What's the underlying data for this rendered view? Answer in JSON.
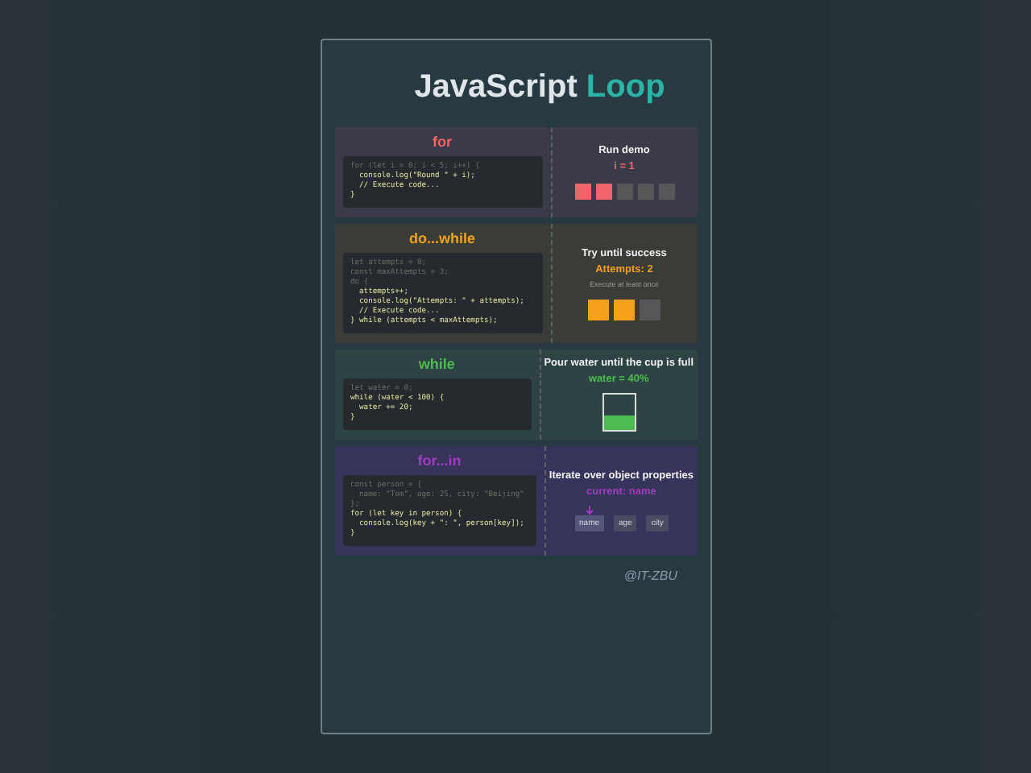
{
  "title": {
    "text": "JavaScript",
    "accent": "Loop"
  },
  "sections": [
    {
      "kind": "squares",
      "heading": "for",
      "color": "#f0656a",
      "code": [
        {
          "text": "for (let i = 0; i < 5; i++) {",
          "dim": true
        },
        {
          "text": "  console.log(\"Round \" + i);",
          "dim": false
        },
        {
          "text": "  // Execute code...",
          "dim": false
        },
        {
          "text": "}",
          "dim": false
        }
      ],
      "demo_title": "Run demo",
      "status": "i = 1",
      "cells": [
        {
          "on": true
        },
        {
          "on": true
        },
        {
          "on": false
        },
        {
          "on": false
        },
        {
          "on": false
        }
      ]
    },
    {
      "kind": "squares",
      "heading": "do...while",
      "color": "#f5a01a",
      "code": [
        {
          "text": "let attempts = 0;",
          "dim": true
        },
        {
          "text": "const maxAttempts = 3;",
          "dim": true
        },
        {
          "text": "do {",
          "dim": true
        },
        {
          "text": "  attempts++;",
          "dim": false
        },
        {
          "text": "  console.log(\"Attempts: \" + attempts);",
          "dim": false
        },
        {
          "text": "  // Execute code...",
          "dim": false
        },
        {
          "text": "} while (attempts < maxAttempts);",
          "dim": false
        }
      ],
      "demo_title": "Try until success",
      "status": "Attempts: 2",
      "note": "Execute at least once",
      "cells": [
        {
          "on": true
        },
        {
          "on": true
        },
        {
          "on": false
        }
      ]
    },
    {
      "kind": "cup",
      "heading": "while",
      "color": "#4cbb52",
      "code": [
        {
          "text": "let water = 0;",
          "dim": true
        },
        {
          "text": "while (water < 100) {",
          "dim": false
        },
        {
          "text": "  water += 20;",
          "dim": false
        },
        {
          "text": "}",
          "dim": false
        }
      ],
      "demo_title": "Pour water until the cup is full",
      "status": "water = 40%",
      "level": 0.4
    },
    {
      "kind": "tags",
      "heading": "for...in",
      "color": "#a23bc0",
      "code": [
        {
          "text": "const person = {",
          "dim": true
        },
        {
          "text": "  name: \"Tom\", age: 25, city: \"Beijing\"",
          "dim": true
        },
        {
          "text": "};",
          "dim": true
        },
        {
          "text": "for (let key in person) {",
          "dim": false
        },
        {
          "text": "  console.log(key + \": \", person[key]);",
          "dim": false
        },
        {
          "text": "}",
          "dim": false
        }
      ],
      "demo_title": "Iterate over object properties",
      "status": "current: name",
      "tags": [
        {
          "label": "name",
          "selected": true
        },
        {
          "label": "age",
          "selected": false
        },
        {
          "label": "city",
          "selected": false
        }
      ]
    }
  ],
  "credit": "@IT-ZBU"
}
